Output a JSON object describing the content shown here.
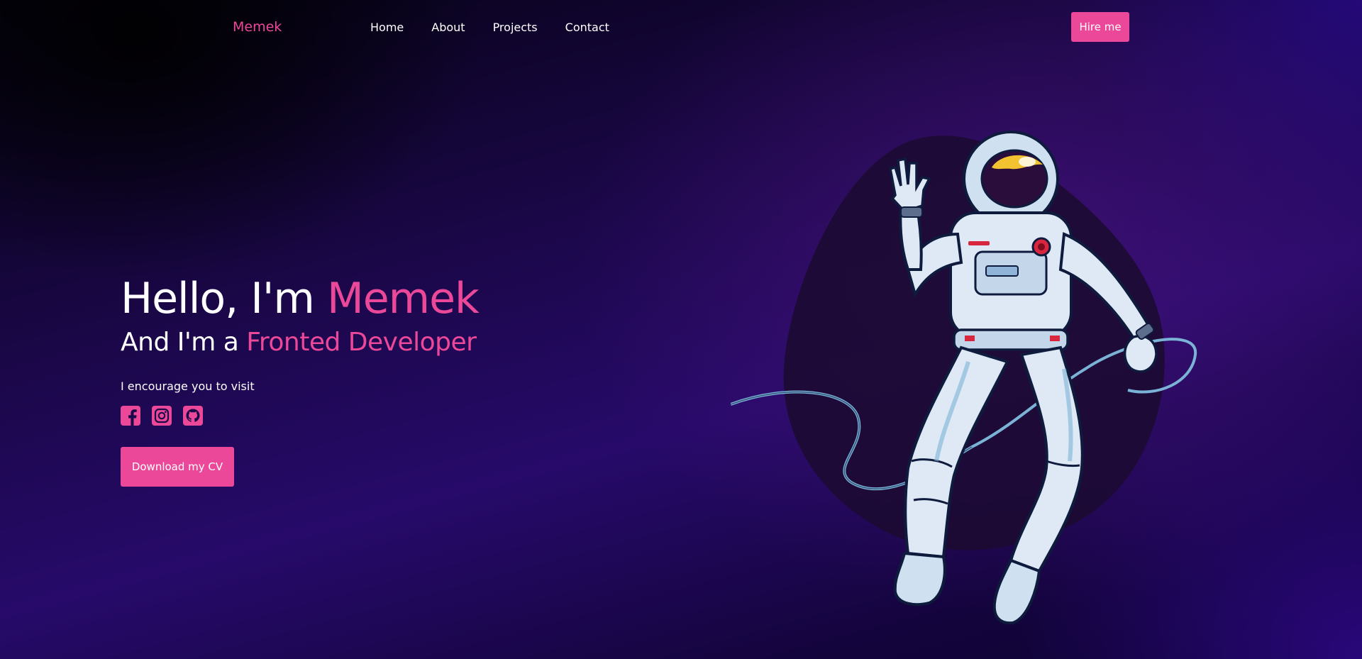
{
  "nav": {
    "logo": "Memek",
    "links": [
      "Home",
      "About",
      "Projects",
      "Contact"
    ],
    "hire_label": "Hire me"
  },
  "hero": {
    "greeting_prefix": "Hello, I'm ",
    "name": "Memek",
    "role_prefix": "And I'm a ",
    "role": "Fronted Developer",
    "tagline": "I encourage you to visit",
    "socials": [
      "facebook-icon",
      "instagram-icon",
      "github-icon"
    ],
    "cv_label": "Download my CV"
  },
  "colors": {
    "accent": "#ec4899",
    "background_dark": "#050212",
    "background_purple": "#270a6a"
  },
  "illustration": {
    "icon": "astronaut-illustration"
  }
}
